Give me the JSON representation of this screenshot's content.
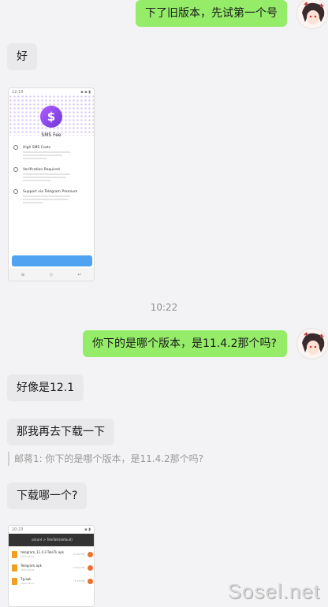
{
  "messages": [
    {
      "id": "m1",
      "side": "out",
      "text": "下了旧版本，先试第一个号"
    },
    {
      "id": "m2",
      "side": "in",
      "text": "好"
    },
    {
      "id": "m3",
      "side": "in",
      "type": "image",
      "caption": "SMS Fee"
    },
    {
      "id": "m4",
      "side": "out",
      "text": "你下的是哪个版本，是11.4.2那个吗?"
    },
    {
      "id": "m5",
      "side": "in",
      "text": "好像是12.1"
    },
    {
      "id": "m6",
      "side": "in",
      "text": "那我再去下载一下"
    },
    {
      "id": "m7",
      "side": "in",
      "text": "下载哪一个?"
    }
  ],
  "time_separator": "10:22",
  "quote": {
    "text": "邮蒋1: 你下的是哪个版本，是11.4.2那个吗?"
  },
  "sms_screenshot": {
    "status_time": "12:19",
    "title": "SMS Fee",
    "coin_symbol": "$",
    "features": [
      {
        "title": "High SMS Costs",
        "icon": "coins-icon"
      },
      {
        "title": "Verification Required",
        "icon": "phone-icon"
      },
      {
        "title": "Support via Telegram Premium",
        "icon": "star-icon"
      }
    ],
    "nav": [
      "≡",
      "◇",
      "↩"
    ]
  },
  "file_screenshot": {
    "status_time": "10:23",
    "path": "sdcard > TeleTalk(default)",
    "files": [
      {
        "name": "telegram_11.4.2-TeleTk.apk",
        "meta": "2024-08-21",
        "size": "24.66 MB"
      },
      {
        "name": "Telegram.apk",
        "meta": "2024-08-21",
        "size": "23.61 MB"
      },
      {
        "name": "Tg.apk",
        "meta": "2024-08-21",
        "size": "75.93 MB"
      }
    ]
  },
  "watermark": "Sosel.net",
  "colors": {
    "outgoing_bubble": "#95ec69",
    "incoming_bubble": "#e9e9ec",
    "background": "#f3f3f5"
  }
}
